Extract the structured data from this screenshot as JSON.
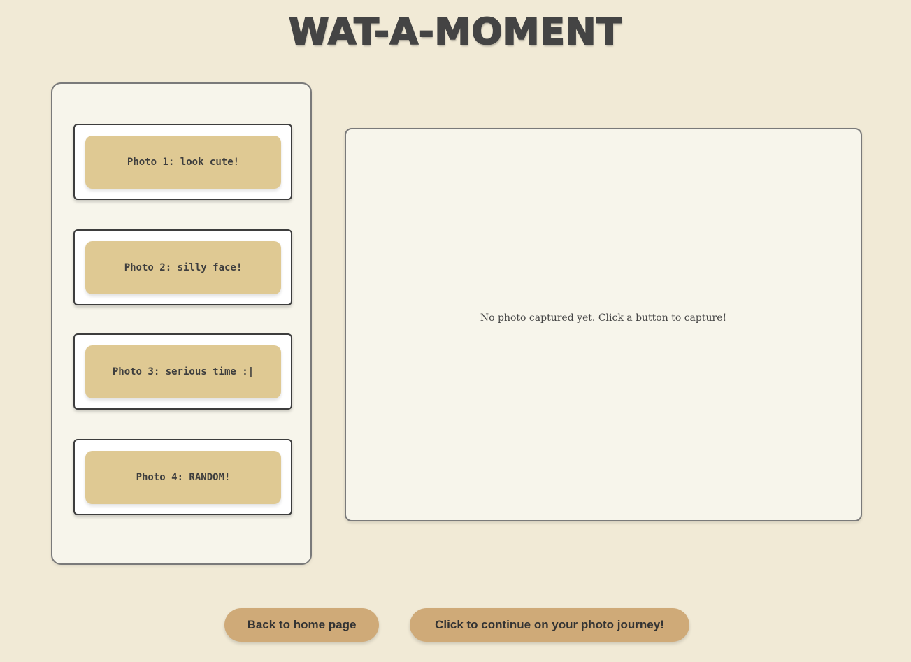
{
  "header": {
    "title": "WAT-A-MOMENT"
  },
  "photo_buttons": [
    {
      "label": "Photo 1: look cute!"
    },
    {
      "label": "Photo 2: silly face!"
    },
    {
      "label": "Photo 3: serious time :|"
    },
    {
      "label": "Photo 4: RANDOM!"
    }
  ],
  "preview": {
    "empty_message": "No photo captured yet. Click a button to capture!"
  },
  "footer": {
    "back_label": "Back to home page",
    "continue_label": "Click to continue on your photo journey!"
  },
  "colors": {
    "background": "#f1ead6",
    "panel": "#f7f5eb",
    "photo_button": "#dfc993",
    "footer_button": "#cfaa78",
    "text": "#3e3e3e"
  }
}
